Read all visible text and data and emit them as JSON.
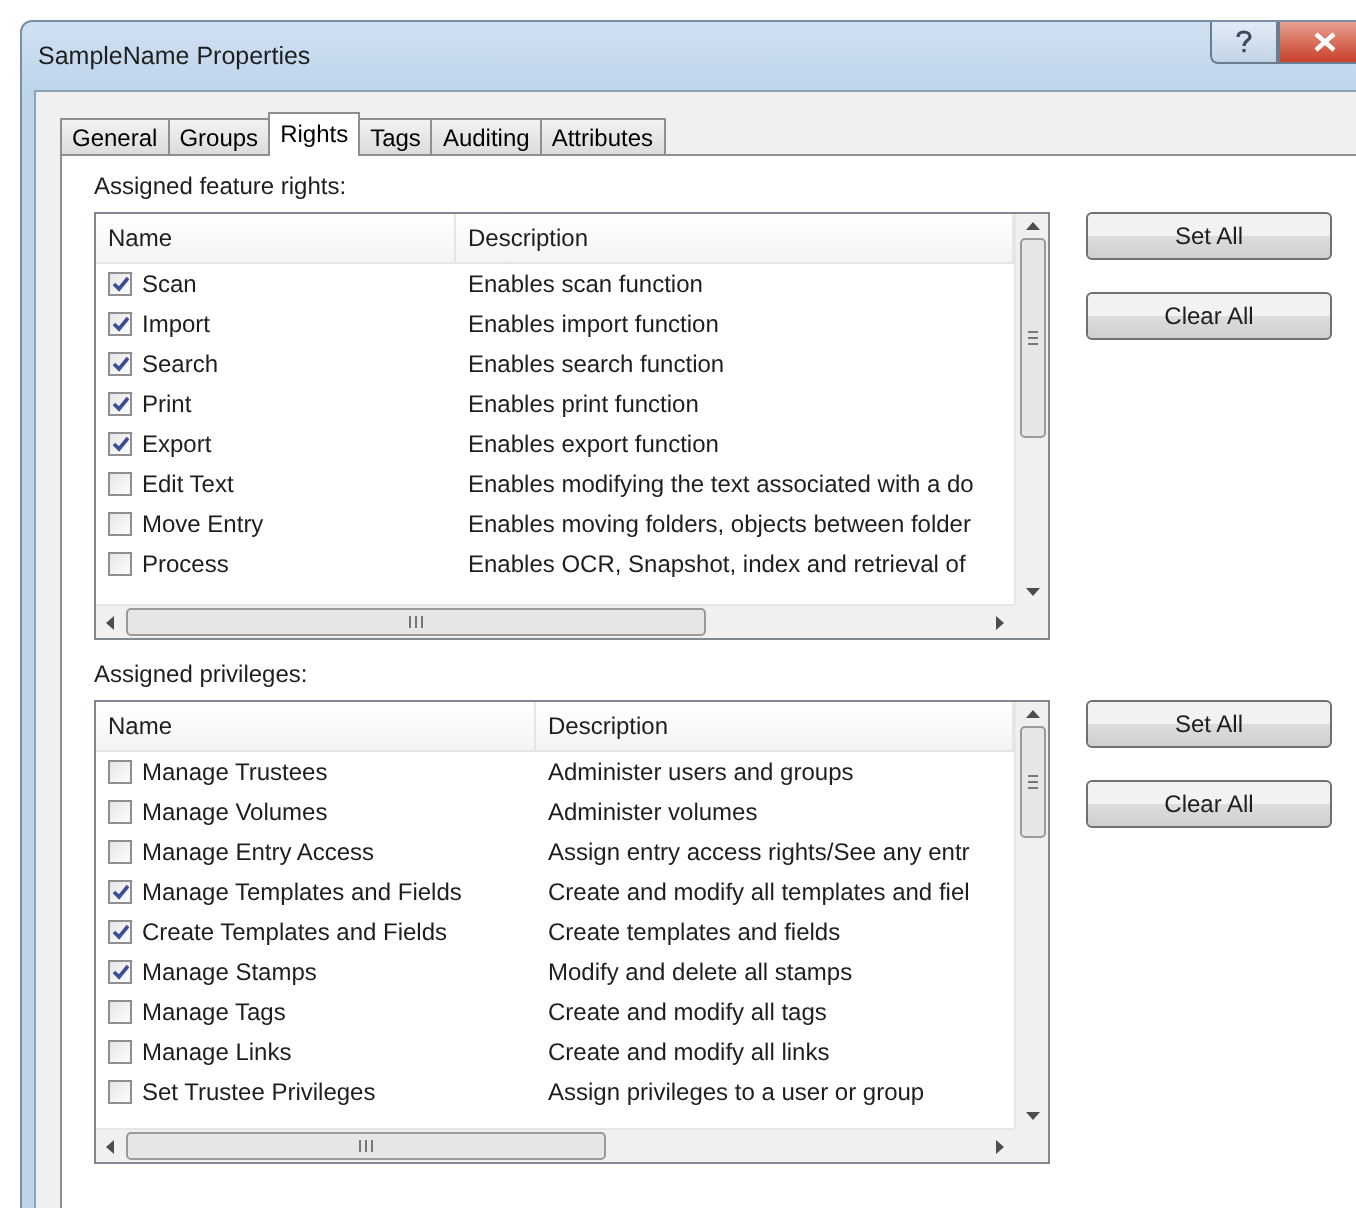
{
  "window": {
    "title": "SampleName Properties"
  },
  "tabs": [
    {
      "label": "General",
      "selected": false
    },
    {
      "label": "Groups",
      "selected": false
    },
    {
      "label": "Rights",
      "selected": true
    },
    {
      "label": "Tags",
      "selected": false
    },
    {
      "label": "Auditing",
      "selected": false
    },
    {
      "label": "Attributes",
      "selected": false
    }
  ],
  "sections": [
    {
      "label": "Assigned feature rights:",
      "columns": [
        "Name",
        "Description"
      ],
      "buttons": [
        "Set All",
        "Clear All"
      ],
      "rows": [
        {
          "name": "Scan",
          "description": "Enables scan function",
          "checked": true
        },
        {
          "name": "Import",
          "description": "Enables import function",
          "checked": true
        },
        {
          "name": "Search",
          "description": "Enables search function",
          "checked": true
        },
        {
          "name": "Print",
          "description": "Enables print function",
          "checked": true
        },
        {
          "name": "Export",
          "description": "Enables export function",
          "checked": true
        },
        {
          "name": "Edit Text",
          "description": "Enables modifying the text associated with a do",
          "checked": false
        },
        {
          "name": "Move Entry",
          "description": "Enables moving folders, objects between folder",
          "checked": false
        },
        {
          "name": "Process",
          "description": "Enables OCR, Snapshot, index and retrieval of",
          "checked": false
        }
      ]
    },
    {
      "label": "Assigned privileges:",
      "columns": [
        "Name",
        "Description"
      ],
      "buttons": [
        "Set All",
        "Clear All"
      ],
      "rows": [
        {
          "name": "Manage Trustees",
          "description": "Administer users and groups",
          "checked": false
        },
        {
          "name": "Manage Volumes",
          "description": "Administer volumes",
          "checked": false
        },
        {
          "name": "Manage Entry Access",
          "description": "Assign entry access rights/See any entr",
          "checked": false
        },
        {
          "name": "Manage Templates and Fields",
          "description": "Create and modify all templates and fiel",
          "checked": true
        },
        {
          "name": "Create Templates and Fields",
          "description": "Create templates and fields",
          "checked": true
        },
        {
          "name": "Manage Stamps",
          "description": "Modify and delete all stamps",
          "checked": true
        },
        {
          "name": "Manage Tags",
          "description": "Create and modify all tags",
          "checked": false
        },
        {
          "name": "Manage Links",
          "description": "Create and modify all links",
          "checked": false
        },
        {
          "name": "Set Trustee Privileges",
          "description": "Assign privileges to a user or group",
          "checked": false
        }
      ]
    }
  ]
}
